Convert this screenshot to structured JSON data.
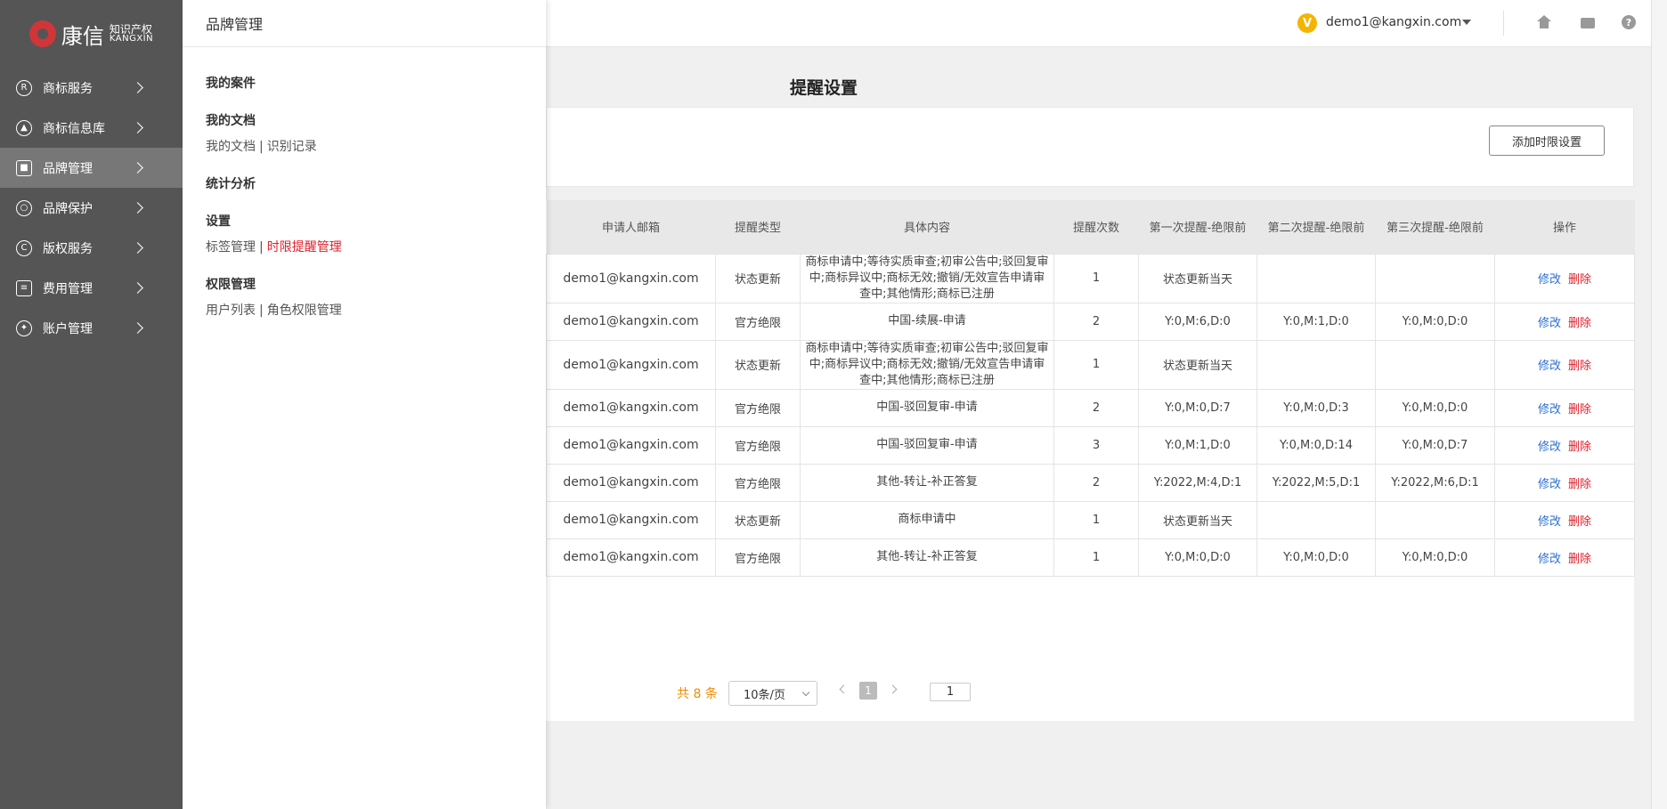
{
  "brand": {
    "cn": "康信",
    "sub1": "知识产权",
    "sub2": "KANGXIN",
    "accent": "#d0353a"
  },
  "sidebar": {
    "items": [
      {
        "label": "商标服务",
        "icon": "registered-icon"
      },
      {
        "label": "商标信息库",
        "icon": "chart-icon"
      },
      {
        "label": "品牌管理",
        "icon": "briefcase-icon",
        "active": true
      },
      {
        "label": "品牌保护",
        "icon": "ribbon-icon"
      },
      {
        "label": "版权服务",
        "icon": "copyright-icon"
      },
      {
        "label": "费用管理",
        "icon": "ledger-icon"
      },
      {
        "label": "账户管理",
        "icon": "gear-icon"
      }
    ]
  },
  "flyout": {
    "title": "品牌管理",
    "sections": [
      {
        "heading": "我的案件",
        "links": []
      },
      {
        "heading": "我的文档",
        "links": [
          "我的文档",
          "识别记录"
        ]
      },
      {
        "heading": "统计分析",
        "links": []
      },
      {
        "heading": "设置",
        "links": [
          "标签管理",
          "时限提醒管理"
        ],
        "active_link": "时限提醒管理"
      },
      {
        "heading": "权限管理",
        "links": [
          "用户列表",
          "角色权限管理"
        ]
      }
    ]
  },
  "header": {
    "user_email": "demo1@kangxin.com",
    "badge": "V"
  },
  "main": {
    "title": "提醒设置",
    "add_button": "添加时限设置",
    "columns": [
      "申请人邮箱",
      "提醒类型",
      "具体内容",
      "提醒次数",
      "第一次提醒-绝限前",
      "第二次提醒-绝限前",
      "第三次提醒-绝限前",
      "操作"
    ],
    "actions": {
      "edit": "修改",
      "delete": "删除"
    },
    "rows": [
      {
        "email": "demo1@kangxin.com",
        "type": "状态更新",
        "content": "商标申请中;等待实质审查;初审公告中;驳回复审中;商标异议中;商标无效;撤销/无效宣告申请审查中;其他情形;商标已注册",
        "count": "1",
        "first": "状态更新当天",
        "second": "",
        "third": ""
      },
      {
        "email": "demo1@kangxin.com",
        "type": "官方绝限",
        "content": "中国-续展-申请",
        "count": "2",
        "first": "Y:0,M:6,D:0",
        "second": "Y:0,M:1,D:0",
        "third": "Y:0,M:0,D:0"
      },
      {
        "email": "demo1@kangxin.com",
        "type": "状态更新",
        "content": "商标申请中;等待实质审查;初审公告中;驳回复审中;商标异议中;商标无效;撤销/无效宣告申请审查中;其他情形;商标已注册",
        "count": "1",
        "first": "状态更新当天",
        "second": "",
        "third": ""
      },
      {
        "email": "demo1@kangxin.com",
        "type": "官方绝限",
        "content": "中国-驳回复审-申请",
        "count": "2",
        "first": "Y:0,M:0,D:7",
        "second": "Y:0,M:0,D:3",
        "third": "Y:0,M:0,D:0"
      },
      {
        "email": "demo1@kangxin.com",
        "type": "官方绝限",
        "content": "中国-驳回复审-申请",
        "count": "3",
        "first": "Y:0,M:1,D:0",
        "second": "Y:0,M:0,D:14",
        "third": "Y:0,M:0,D:7"
      },
      {
        "email": "demo1@kangxin.com",
        "type": "官方绝限",
        "content": "其他-转让-补正答复",
        "count": "2",
        "first": "Y:2022,M:4,D:1",
        "second": "Y:2022,M:5,D:1",
        "third": "Y:2022,M:6,D:1"
      },
      {
        "email": "demo1@kangxin.com",
        "type": "状态更新",
        "content": "商标申请中",
        "count": "1",
        "first": "状态更新当天",
        "second": "",
        "third": ""
      },
      {
        "email": "demo1@kangxin.com",
        "type": "官方绝限",
        "content": "其他-转让-补正答复",
        "count": "1",
        "first": "Y:0,M:0,D:0",
        "second": "Y:0,M:0,D:0",
        "third": "Y:0,M:0,D:0"
      }
    ]
  },
  "pagination": {
    "total": "共 8 条",
    "page_size": "10条/页",
    "current_page": "1",
    "goto_value": "1"
  }
}
